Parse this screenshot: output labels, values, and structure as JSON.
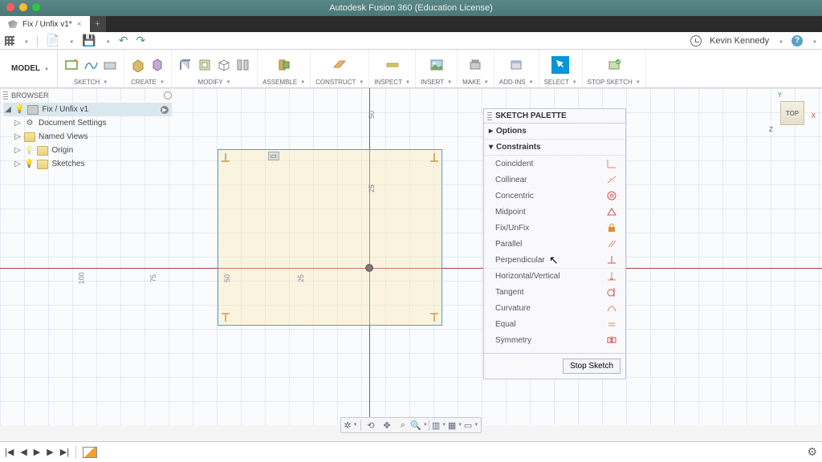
{
  "app": {
    "title": "Autodesk Fusion 360 (Education License)"
  },
  "doc": {
    "tab_name": "Fix / Unfix v1*"
  },
  "qat": {
    "user_name": "Kevin Kennedy"
  },
  "ribbon": {
    "model_label": "MODEL",
    "groups": [
      {
        "label": "SKETCH",
        "icons": [
          "sketch-rect",
          "sketch-spline",
          "sketch-plane"
        ]
      },
      {
        "label": "CREATE",
        "icons": [
          "extrude",
          "revolve"
        ]
      },
      {
        "label": "MODIFY",
        "icons": [
          "fillet",
          "presspull",
          "shell",
          "splitbody"
        ]
      },
      {
        "label": "ASSEMBLE",
        "icons": [
          "joint"
        ]
      },
      {
        "label": "CONSTRUCT",
        "icons": [
          "plane"
        ]
      },
      {
        "label": "INSPECT",
        "icons": [
          "measure"
        ]
      },
      {
        "label": "INSERT",
        "icons": [
          "decal"
        ]
      },
      {
        "label": "MAKE",
        "icons": [
          "print"
        ]
      },
      {
        "label": "ADD-INS",
        "icons": [
          "addin"
        ]
      },
      {
        "label": "SELECT",
        "icons": [
          "select"
        ],
        "selected": true
      },
      {
        "label": "STOP SKETCH",
        "icons": [
          "stop"
        ]
      }
    ]
  },
  "browser": {
    "title": "BROWSER",
    "root": "Fix / Unfix v1",
    "items": [
      "Document Settings",
      "Named Views",
      "Origin",
      "Sketches"
    ]
  },
  "canvas": {
    "ruler_top": "50",
    "ruler_left": [
      "100",
      "75",
      "50",
      "25"
    ],
    "dim_v": "25"
  },
  "viewcube": {
    "face": "TOP",
    "x": "X",
    "y": "Y",
    "z": "Z"
  },
  "palette": {
    "title": "SKETCH PALETTE",
    "sections": {
      "options": "Options",
      "constraints": "Constraints"
    },
    "constraints": [
      "Coincident",
      "Collinear",
      "Concentric",
      "Midpoint",
      "Fix/UnFix",
      "Parallel",
      "Perpendicular",
      "Horizontal/Vertical",
      "Tangent",
      "Curvature",
      "Equal",
      "Symmetry"
    ],
    "stop": "Stop Sketch"
  }
}
